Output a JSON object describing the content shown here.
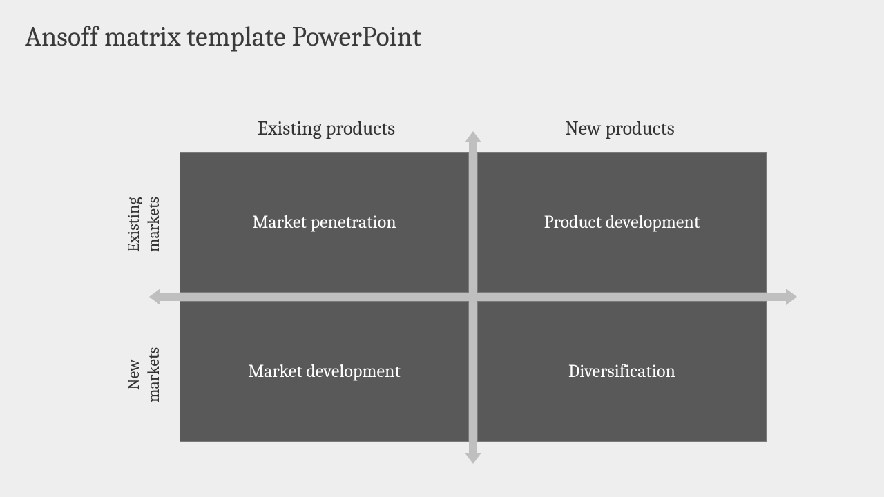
{
  "title": "Ansoff matrix template PowerPoint",
  "columns": {
    "left": "Existing products",
    "right": "New products"
  },
  "rows": {
    "top": "Existing\nmarkets",
    "bottom": "New\nmarkets"
  },
  "cells": {
    "top_left": "Market penetration",
    "top_right": "Product development",
    "bottom_left": "Market development",
    "bottom_right": "Diversification"
  }
}
